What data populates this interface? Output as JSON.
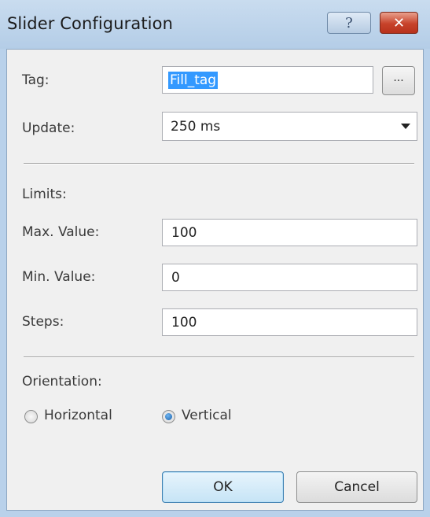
{
  "window": {
    "title": "Slider Configuration",
    "help_label": "?",
    "close_label": "✕"
  },
  "tag": {
    "label": "Tag:",
    "value": "Fill_tag",
    "browse_label": "..."
  },
  "update": {
    "label": "Update:",
    "selected": "250 ms"
  },
  "limits": {
    "heading": "Limits:",
    "max_label": "Max. Value:",
    "max_value": "100",
    "min_label": "Min. Value:",
    "min_value": "0",
    "steps_label": "Steps:",
    "steps_value": "100"
  },
  "orientation": {
    "heading": "Orientation:",
    "horizontal_label": "Horizontal",
    "vertical_label": "Vertical",
    "selected": "Vertical"
  },
  "buttons": {
    "ok_label": "OK",
    "cancel_label": "Cancel"
  },
  "colors": {
    "titlebar": "#b9d1ea",
    "selection": "#3399ff",
    "close": "#c7422a"
  }
}
